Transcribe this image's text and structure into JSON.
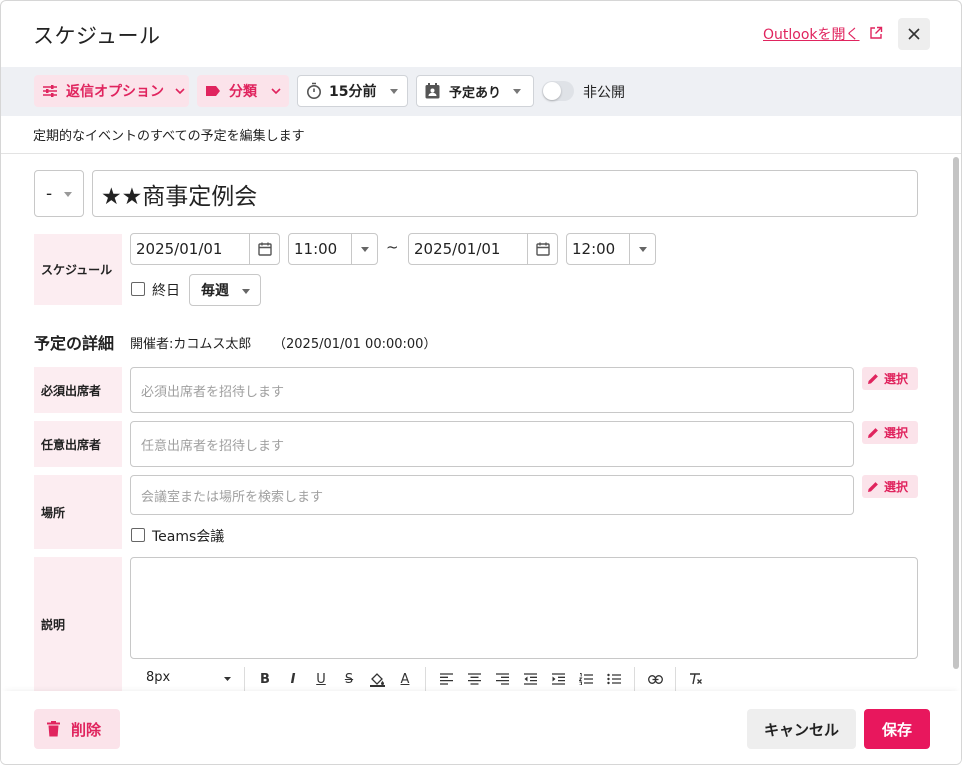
{
  "header": {
    "title": "スケジュール",
    "outlook_link": "Outlookを開く"
  },
  "toolbar": {
    "reply_options": "返信オプション",
    "category": "分類",
    "reminder": "15分前",
    "show_as": "予定あり",
    "private_label": "非公開"
  },
  "recurring_note": "定期的なイベントのすべての予定を編集します",
  "event": {
    "priority": "-",
    "title": "★★商事定例会"
  },
  "schedule": {
    "label": "スケジュール",
    "start_date": "2025/01/01",
    "start_time": "11:00",
    "separator": "~",
    "end_date": "2025/01/01",
    "end_time": "12:00",
    "all_day_label": "終日",
    "recurrence": "毎週"
  },
  "details": {
    "section_title": "予定の詳細",
    "organizer": "開催者:カコムス太郎",
    "organizer_timestamp": "（2025/01/01 00:00:00）",
    "required_label": "必須出席者",
    "required_placeholder": "必須出席者を招待します",
    "optional_label": "任意出席者",
    "optional_placeholder": "任意出席者を招待します",
    "location_label": "場所",
    "location_placeholder": "会議室または場所を検索します",
    "select_label": "選択",
    "teams_label": "Teams会議",
    "description_label": "説明"
  },
  "editor": {
    "font_size": "8px",
    "bold": "B",
    "italic": "I",
    "underline": "U",
    "strike": "S",
    "font_color": "A"
  },
  "footer": {
    "delete": "削除",
    "cancel": "キャンセル",
    "save": "保存"
  },
  "colors": {
    "accent": "#e0245e",
    "accent_bg": "#fbe3ea",
    "label_bg": "#fcedf1",
    "toolbar_bg": "#eef0f4"
  }
}
